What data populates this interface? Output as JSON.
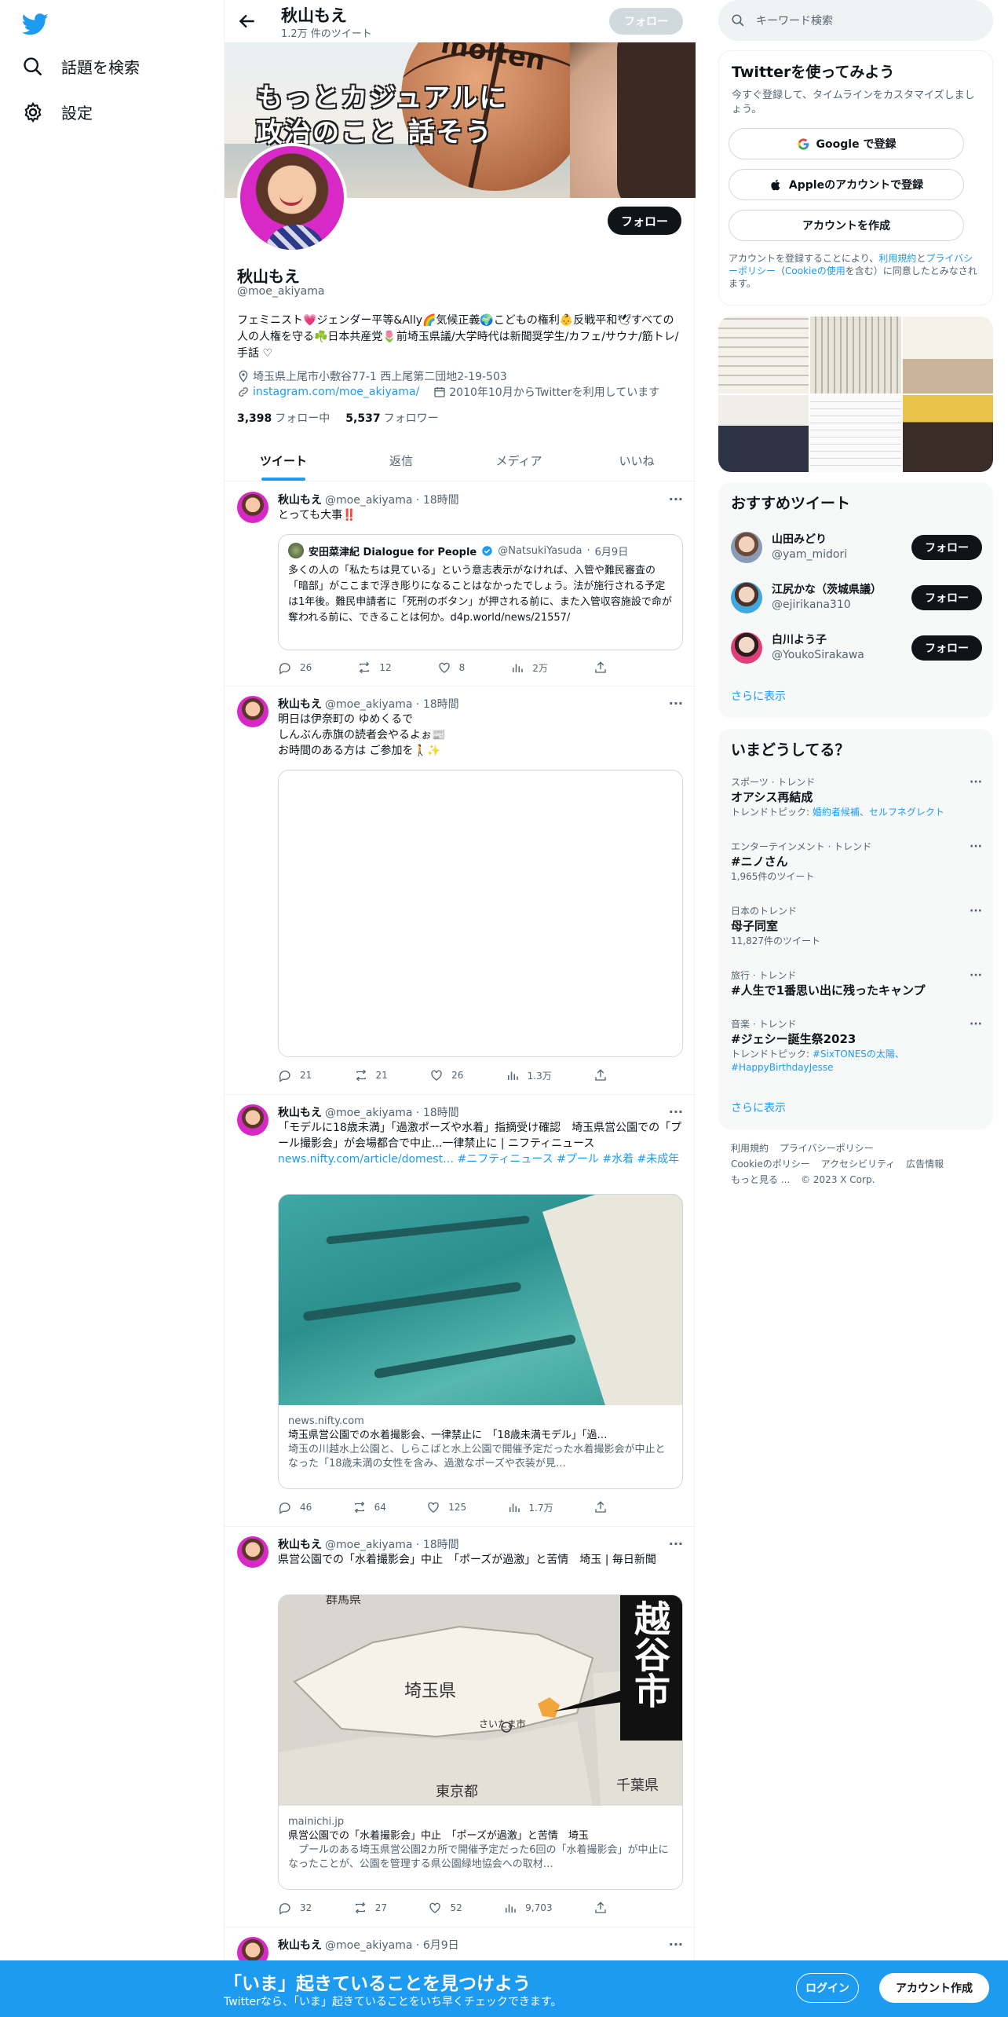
{
  "nav": {
    "explore_label": "話題を検索",
    "settings_label": "設定"
  },
  "header": {
    "name": "秋山もえ",
    "tweet_count": "1.2万 件のツイート",
    "follow_label": "フォロー"
  },
  "banner": {
    "line1": "もっとカジュアルに",
    "line2": "政治のこと 話そう",
    "ball_brand": "molten"
  },
  "profile": {
    "name": "秋山もえ",
    "handle": "@moe_akiyama",
    "follow_label": "フォロー",
    "bio": "フェミニスト💗ジェンダー平等&Ally🌈気候正義🌍こどもの権利👶反戦平和🕊すべての人の人権を守る☘️日本共産党🌷前埼玉県議/大学時代は新聞奨学生/カフェ/サウナ/筋トレ/手話 ♡",
    "location": "埼玉県上尾市小敷谷77-1 西上尾第二団地2-19-503",
    "website": "instagram.com/moe_akiyama/",
    "joined": "2010年10月からTwitterを利用しています",
    "following_count": "3,398",
    "following_label": "フォロー中",
    "followers_count": "5,537",
    "followers_label": "フォロワー"
  },
  "tabs": [
    "ツイート",
    "返信",
    "メディア",
    "いいね"
  ],
  "tweets": [
    {
      "name": "秋山もえ",
      "handle": "@moe_akiyama",
      "time": "18時間",
      "text": "とっても大事‼️",
      "quote": {
        "name": "安田菜津紀 Dialogue for People",
        "handle": "@NatsukiYasuda",
        "time": "6月9日",
        "text": "多くの人の「私たちは見ている」という意志表示がなければ、入管や難民審査の「暗部」がここまで浮き彫りになることはなかったでしょう。法が施行される予定は1年後。難民申請者に「死刑のボタン」が押される前に、また入管収容施設で命が奪われる前に、できることは何か。d4p.world/news/21557/"
      },
      "replies": "26",
      "retweets": "12",
      "likes": "8",
      "views": "2万"
    },
    {
      "name": "秋山もえ",
      "handle": "@moe_akiyama",
      "time": "18時間",
      "text1": "明日は伊奈町の ゆめくるで",
      "text2": "しんぶん赤旗の読者会やるよぉ📰",
      "text3": "お時間のある方は ご参加を🚶✨",
      "replies": "21",
      "retweets": "21",
      "likes": "26",
      "views": "1.3万"
    },
    {
      "name": "秋山もえ",
      "handle": "@moe_akiyama",
      "time": "18時間",
      "text": "「モデルに18歳未満」「過激ポーズや水着」指摘受け確認　埼玉県営公園での「プール撮影会」が会場都合で中止...一律禁止に | ニフティニュース",
      "links": "news.nifty.com/article/domest… #ニフティニュース #プール #水着 #未成年",
      "card": {
        "domain": "news.nifty.com",
        "title": "埼玉県営公園での水着撮影会、一律禁止に　「18歳未満モデル」「過…",
        "desc": "埼玉の川越水上公園と、しらこばと水上公園で開催予定だった水着撮影会が中止となった「18歳未満の女性を含み、過激なポーズや衣装が見…"
      },
      "replies": "46",
      "retweets": "64",
      "likes": "125",
      "views": "1.7万"
    },
    {
      "name": "秋山もえ",
      "handle": "@moe_akiyama",
      "time": "18時間",
      "text": "県営公園での「水着撮影会」中止　「ポーズが過激」と苦情　埼玉 | 毎日新聞",
      "card": {
        "domain": "mainichi.jp",
        "title": "県営公園での「水着撮影会」中止　「ポーズが過激」と苦情　埼玉",
        "desc": "　プールのある埼玉県営公園2カ所で開催予定だった6回の「水着撮影会」が中止になったことが、公園を管理する県公園緑地協会への取材…",
        "map_gunma": "群馬県",
        "map_saitama": "埼玉県",
        "map_saitama_city": "さいたま市",
        "map_tokyo": "東京都",
        "map_chiba": "千葉県",
        "map_koshigaya": "越谷市"
      },
      "replies": "32",
      "retweets": "27",
      "likes": "52",
      "views": "9,703"
    },
    {
      "name": "秋山もえ",
      "handle": "@moe_akiyama",
      "time": "6月9日"
    }
  ],
  "search": {
    "placeholder": "キーワード検索"
  },
  "signup": {
    "title": "Twitterを使ってみよう",
    "subtitle": "今すぐ登録して、タイムラインをカスタマイズしましょう。",
    "google": "Google で登録",
    "apple": "Appleのアカウントで登録",
    "create": "アカウントを作成",
    "note_a": "アカウントを登録することにより、",
    "note_terms": "利用規約",
    "note_b": "と",
    "note_privacy": "プライバシーポリシー",
    "note_c": "（",
    "note_cookie": "Cookieの使用",
    "note_d": "を含む）に同意したとみなされます。"
  },
  "recommend": {
    "title": "おすすめツイート",
    "users": [
      {
        "name": "山田みどり",
        "handle": "@yam_midori",
        "btn": "フォロー"
      },
      {
        "name": "江尻かな（茨城県議）",
        "handle": "@ejirikana310",
        "btn": "フォロー"
      },
      {
        "name": "白川よう子",
        "handle": "@YoukoSirakawa",
        "btn": "フォロー"
      }
    ],
    "more": "さらに表示"
  },
  "trends": {
    "title": "いまどうしてる？",
    "items": [
      {
        "context": "スポーツ · トレンド",
        "name": "オアシス再結成",
        "sub_label": "トレンドトピック: ",
        "sub": "婚約者候補、セルフネグレクト"
      },
      {
        "context": "エンターテインメント · トレンド",
        "name": "#ニノさん",
        "sub": "1,965件のツイート"
      },
      {
        "context": "日本のトレンド",
        "name": "母子同室",
        "sub": "11,827件のツイート"
      },
      {
        "context": "旅行 · トレンド",
        "name": "#人生で1番思い出に残ったキャンプ"
      },
      {
        "context": "音楽 · トレンド",
        "name": "#ジェシー誕生祭2023",
        "sub_label": "トレンドトピック: ",
        "sub": "#SixTONESの太陽、#HappyBirthdayJesse"
      }
    ],
    "more": "さらに表示"
  },
  "footer": [
    "利用規約",
    "プライバシーポリシー",
    "Cookieのポリシー",
    "アクセシビリティ",
    "広告情報",
    "もっと見る ...",
    "© 2023 X Corp."
  ],
  "bottom": {
    "title": "「いま」起きていることを見つけよう",
    "sub": "Twitterなら、「いま」起きていることをいち早くチェックできます。",
    "login": "ログイン",
    "signup": "アカウント作成"
  },
  "colors": {
    "accent": "#1d9bf0",
    "text": "#0f1419",
    "muted": "#536471",
    "border": "#eff3f4"
  }
}
